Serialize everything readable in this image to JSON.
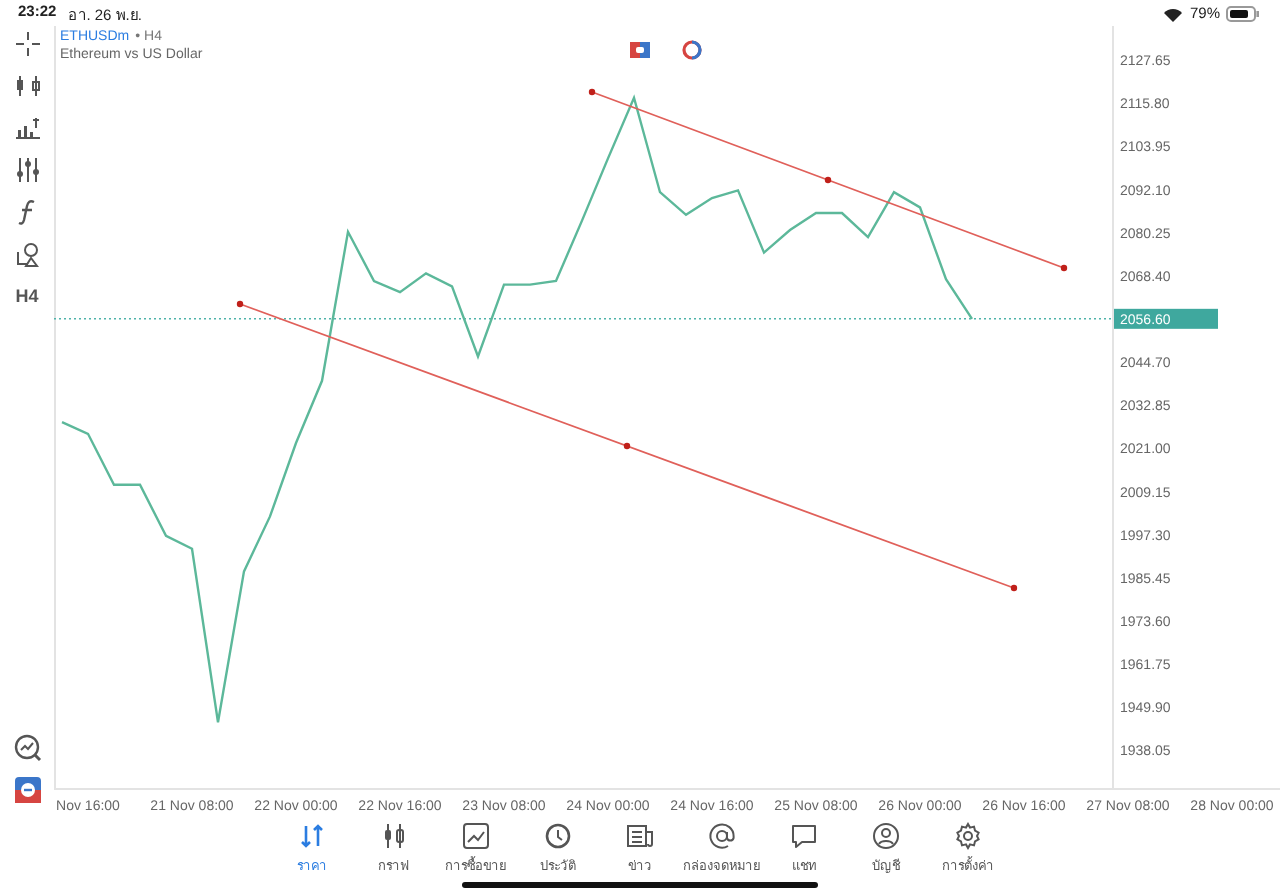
{
  "status_bar": {
    "time": "23:22",
    "date": "อา. 26 พ.ย.",
    "battery_text": "79%"
  },
  "toolbar": {
    "tools": [
      {
        "kind": "crosshair"
      },
      {
        "kind": "chart_type"
      },
      {
        "kind": "indicators"
      },
      {
        "kind": "settings"
      },
      {
        "kind": "function"
      },
      {
        "kind": "objects"
      },
      {
        "kind": "timeframe",
        "label": "H4"
      }
    ],
    "bottom_tools": [
      {
        "kind": "zoom"
      },
      {
        "kind": "trade"
      }
    ]
  },
  "chart": {
    "symbol": "ETHUSDm",
    "period": "• H4",
    "description": "Ethereum vs US Dollar",
    "chart_data": {
      "type": "line",
      "categories": [
        null,
        "Nov 16:00",
        null,
        null,
        null,
        "21 Nov 08:00",
        null,
        null,
        null,
        "22 Nov 00:00",
        null,
        null,
        null,
        "22 Nov 16:00",
        null,
        null,
        null,
        "23 Nov 08:00",
        null,
        null,
        null,
        "24 Nov 00:00",
        null,
        null,
        null,
        "24 Nov 16:00",
        null,
        null,
        null,
        "25 Nov 08:00",
        null,
        null,
        null,
        "26 Nov 00:00",
        null,
        null,
        null,
        "26 Nov 16:00",
        null,
        null,
        null,
        "27 Nov 08:00",
        null,
        null,
        null,
        "28 Nov 00:00",
        null
      ],
      "series": [
        {
          "color": "#5cb89a",
          "values": [
            2028.2,
            2025.0,
            2011.0,
            2011.0,
            1997.0,
            1993.4,
            1945.8,
            1987.2,
            2002.3,
            2022.5,
            2039.6,
            2080.5,
            2067.0,
            2063.9,
            2069.1,
            2065.5,
            2046.3,
            2066.0,
            2066.0,
            2067.0,
            2083.6,
            2100.7,
            2117.3,
            2091.4,
            2085.2,
            2089.8,
            2091.9,
            2074.8,
            2081.0,
            2085.7,
            2085.7,
            2079.0,
            2091.4,
            2087.2,
            2067.5,
            2056.6,
            null,
            null,
            null,
            null,
            null,
            null,
            null,
            null,
            null,
            null,
            null
          ]
        }
      ],
      "ylim": [
        1927.7,
        2136.5
      ],
      "ref_lines": [
        {
          "axis": "y",
          "value": 2056.6,
          "color": "#4fb3a9"
        }
      ],
      "yticks": [
        {
          "value": 2127.65,
          "label": "2127.65"
        },
        {
          "value": 2115.8,
          "label": "2115.80"
        },
        {
          "value": 2103.95,
          "label": "2103.95"
        },
        {
          "value": 2092.1,
          "label": "2092.10"
        },
        {
          "value": 2080.25,
          "label": "2080.25"
        },
        {
          "value": 2068.4,
          "label": "2068.40"
        },
        {
          "value": 2056.6,
          "label": "2056.60"
        },
        {
          "value": 2044.7,
          "label": "2044.70"
        },
        {
          "value": 2032.85,
          "label": "2032.85"
        },
        {
          "value": 2021.0,
          "label": "2021.00"
        },
        {
          "value": 2009.15,
          "label": "2009.15"
        },
        {
          "value": 1997.3,
          "label": "1997.30"
        },
        {
          "value": 1985.45,
          "label": "1985.45"
        },
        {
          "value": 1973.6,
          "label": "1973.60"
        },
        {
          "value": 1961.75,
          "label": "1961.75"
        },
        {
          "value": 1949.9,
          "label": "1949.90"
        },
        {
          "value": 1938.05,
          "label": "1938.05"
        }
      ]
    }
  },
  "tab_bar": {
    "tabs": [
      {
        "kind": "quotes",
        "label": "ราคา",
        "selected": true
      },
      {
        "kind": "chart",
        "label": "กราฟ",
        "selected": false
      },
      {
        "kind": "trade",
        "label": "การซื้อขาย",
        "selected": false
      },
      {
        "kind": "history",
        "label": "ประวัติ",
        "selected": false
      },
      {
        "kind": "news",
        "label": "ข่าว",
        "selected": false
      },
      {
        "kind": "mail",
        "label": "กล่องจดหมาย",
        "selected": false
      },
      {
        "kind": "chat",
        "label": "แชท",
        "selected": false
      },
      {
        "kind": "account",
        "label": "บัญชี",
        "selected": false
      },
      {
        "kind": "settings",
        "label": "การตั้งค่า",
        "selected": false
      }
    ]
  }
}
